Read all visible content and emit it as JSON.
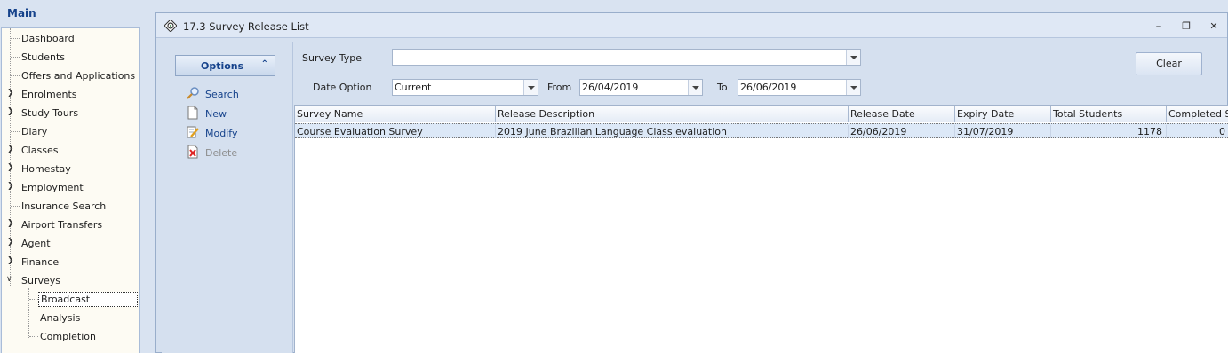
{
  "nav": {
    "title": "Main",
    "items": [
      {
        "label": "Dashboard",
        "expandable": false
      },
      {
        "label": "Students",
        "expandable": false
      },
      {
        "label": "Offers and Applications",
        "expandable": false
      },
      {
        "label": "Enrolments",
        "expandable": true
      },
      {
        "label": "Study Tours",
        "expandable": true
      },
      {
        "label": "Diary",
        "expandable": false
      },
      {
        "label": "Classes",
        "expandable": true
      },
      {
        "label": "Homestay",
        "expandable": true
      },
      {
        "label": "Employment",
        "expandable": true
      },
      {
        "label": "Insurance Search",
        "expandable": false
      },
      {
        "label": "Airport Transfers",
        "expandable": true
      },
      {
        "label": "Agent",
        "expandable": true
      },
      {
        "label": "Finance",
        "expandable": true
      },
      {
        "label": "Surveys",
        "expandable": true,
        "expanded": true
      }
    ],
    "survey_children": [
      "Broadcast",
      "Analysis",
      "Completion"
    ],
    "selected": "Broadcast"
  },
  "window": {
    "title": "17.3 Survey Release List",
    "buttons": {
      "minimize": "⎯",
      "restore": "❐",
      "close": "✕"
    }
  },
  "options": {
    "header": "Options",
    "chevron": "⌃",
    "actions": [
      {
        "label": "Search",
        "icon": "search-icon",
        "enabled": true
      },
      {
        "label": "New",
        "icon": "new-document-icon",
        "enabled": true
      },
      {
        "label": "Modify",
        "icon": "modify-icon",
        "enabled": true
      },
      {
        "label": "Delete",
        "icon": "delete-icon",
        "enabled": false
      }
    ]
  },
  "filters": {
    "survey_type_label": "Survey Type",
    "survey_type_value": "",
    "date_option_label": "Date Option",
    "date_option_value": "Current",
    "from_label": "From",
    "from_value": "26/04/2019",
    "to_label": "To",
    "to_value": "26/06/2019",
    "clear_label": "Clear"
  },
  "grid": {
    "columns": [
      "Survey Name",
      "Release Description",
      "Release Date",
      "Expiry Date",
      "Total Students",
      "Completed St"
    ],
    "rows": [
      [
        "Course Evaluation Survey",
        "2019 June Brazilian Language Class evaluation",
        "26/06/2019",
        "31/07/2019",
        "1178",
        "0"
      ]
    ]
  },
  "colors": {
    "accent": "#15428b",
    "selection": "#dce8f7",
    "panel": "#d5e0ef"
  }
}
